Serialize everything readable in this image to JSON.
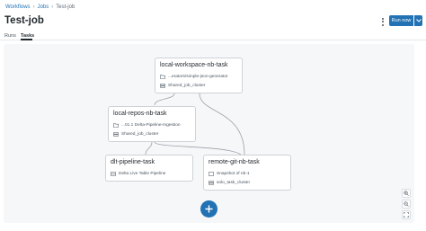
{
  "breadcrumb": {
    "workflows": "Workflows",
    "jobs": "Jobs",
    "current": "Test-job"
  },
  "page": {
    "title": "Test-job"
  },
  "header": {
    "run_now_label": "Run now"
  },
  "tabs": [
    {
      "label": "Runs",
      "active": false
    },
    {
      "label": "Tasks",
      "active": true
    }
  ],
  "tasks": {
    "local_workspace": {
      "title": "local-workspace-nb-task",
      "path": "...erators/simple-json-generator",
      "cluster": "Shared_job_cluster"
    },
    "local_repos": {
      "title": "local-repos-nb-task",
      "path": "...01.1 Delta-Pipeline-Ingestion",
      "cluster": "Shared_job_cluster"
    },
    "dlt_pipeline": {
      "title": "dlt-pipeline-task",
      "pipeline": "Delta Live Table Pipeline"
    },
    "remote_git": {
      "title": "remote-git-nb-task",
      "source": "Snapshot of nb-1",
      "cluster": "solo_task_cluster"
    }
  },
  "colors": {
    "accent": "#2272b4",
    "canvas_bg": "#f6f7f8",
    "edge": "#9aa3ab"
  },
  "icons": [
    "chevron-right-icon",
    "kebab-menu-icon",
    "chevron-down-icon",
    "folder-icon",
    "cluster-icon",
    "pipeline-icon",
    "git-icon",
    "plus-icon",
    "zoom-in-icon",
    "zoom-out-icon",
    "fit-view-icon"
  ]
}
